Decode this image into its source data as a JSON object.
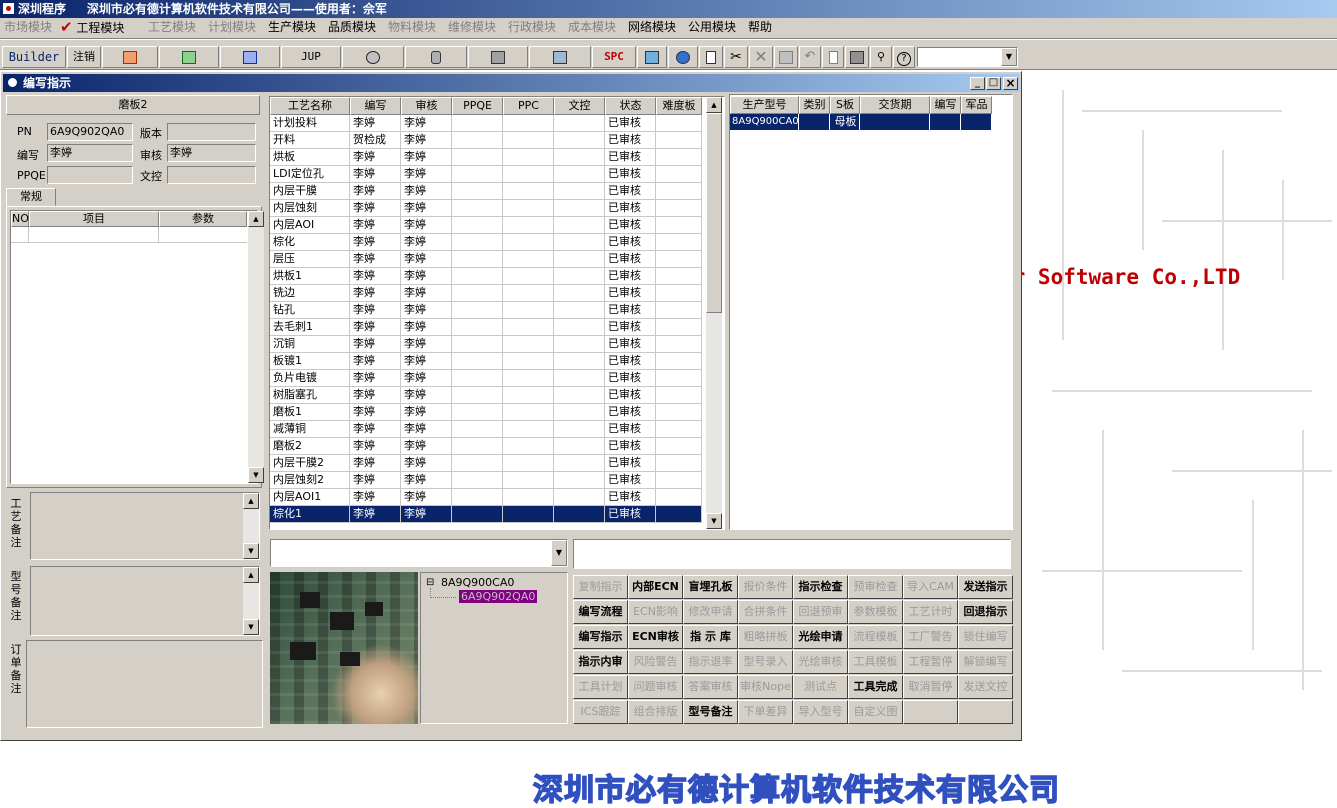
{
  "app": {
    "title_left": "深圳程序",
    "title_main": "深圳市必有德计算机软件技术有限公司——使用者：佘军"
  },
  "menu": [
    {
      "label": "市场模块",
      "enabled": false
    },
    {
      "label": "工程模块",
      "enabled": true,
      "checked": true
    },
    {
      "label": "工艺模块",
      "enabled": false
    },
    {
      "label": "计划模块",
      "enabled": false
    },
    {
      "label": "生产模块",
      "enabled": true
    },
    {
      "label": "品质模块",
      "enabled": true
    },
    {
      "label": "物料模块",
      "enabled": false
    },
    {
      "label": "维修模块",
      "enabled": false
    },
    {
      "label": "行政模块",
      "enabled": false
    },
    {
      "label": "成本模块",
      "enabled": false
    },
    {
      "label": "网络模块",
      "enabled": true
    },
    {
      "label": "公用模块",
      "enabled": true
    },
    {
      "label": "帮助",
      "enabled": true
    }
  ],
  "toolbar": {
    "builder": "Builder",
    "logout": "注销",
    "jup": "JUP",
    "spc": "SPC"
  },
  "window": {
    "title": "编写指示",
    "min": "_",
    "max": "□",
    "close": "×"
  },
  "left": {
    "caption": "磨板2",
    "pn_label": "PN",
    "pn_value": "6A9Q902QA0",
    "version_label": "版本",
    "version_value": "",
    "writer_label": "编写",
    "writer_value": "李婷",
    "review_label": "审核",
    "review_value": "李婷",
    "ppqe_label": "PPQE",
    "ppqe_value": "",
    "doc_label": "文控",
    "doc_value": "",
    "tab": "常规",
    "cols": [
      "NO",
      "项目",
      "参数"
    ],
    "note1": "工艺备注",
    "note2": "型号备注",
    "note3": "订单备注"
  },
  "grid": {
    "headers": [
      "工艺名称",
      "编写",
      "审核",
      "PPQE",
      "PPC",
      "文控",
      "状态",
      "难度板"
    ],
    "rows": [
      [
        "计划投料",
        "李婷",
        "李婷",
        "",
        "",
        "",
        "已审核",
        ""
      ],
      [
        "开料",
        "贺检成",
        "李婷",
        "",
        "",
        "",
        "已审核",
        ""
      ],
      [
        "烘板",
        "李婷",
        "李婷",
        "",
        "",
        "",
        "已审核",
        ""
      ],
      [
        "LDI定位孔",
        "李婷",
        "李婷",
        "",
        "",
        "",
        "已审核",
        ""
      ],
      [
        "内层干膜",
        "李婷",
        "李婷",
        "",
        "",
        "",
        "已审核",
        ""
      ],
      [
        "内层蚀刻",
        "李婷",
        "李婷",
        "",
        "",
        "",
        "已审核",
        ""
      ],
      [
        "内层AOI",
        "李婷",
        "李婷",
        "",
        "",
        "",
        "已审核",
        ""
      ],
      [
        "棕化",
        "李婷",
        "李婷",
        "",
        "",
        "",
        "已审核",
        ""
      ],
      [
        "层压",
        "李婷",
        "李婷",
        "",
        "",
        "",
        "已审核",
        ""
      ],
      [
        "烘板1",
        "李婷",
        "李婷",
        "",
        "",
        "",
        "已审核",
        ""
      ],
      [
        "铣边",
        "李婷",
        "李婷",
        "",
        "",
        "",
        "已审核",
        ""
      ],
      [
        "钻孔",
        "李婷",
        "李婷",
        "",
        "",
        "",
        "已审核",
        ""
      ],
      [
        "去毛刺1",
        "李婷",
        "李婷",
        "",
        "",
        "",
        "已审核",
        ""
      ],
      [
        "沉铜",
        "李婷",
        "李婷",
        "",
        "",
        "",
        "已审核",
        ""
      ],
      [
        "板镀1",
        "李婷",
        "李婷",
        "",
        "",
        "",
        "已审核",
        ""
      ],
      [
        "负片电镀",
        "李婷",
        "李婷",
        "",
        "",
        "",
        "已审核",
        ""
      ],
      [
        "树脂塞孔",
        "李婷",
        "李婷",
        "",
        "",
        "",
        "已审核",
        ""
      ],
      [
        "磨板1",
        "李婷",
        "李婷",
        "",
        "",
        "",
        "已审核",
        ""
      ],
      [
        "减薄铜",
        "李婷",
        "李婷",
        "",
        "",
        "",
        "已审核",
        ""
      ],
      [
        "磨板2",
        "李婷",
        "李婷",
        "",
        "",
        "",
        "已审核",
        ""
      ],
      [
        "内层干膜2",
        "李婷",
        "李婷",
        "",
        "",
        "",
        "已审核",
        ""
      ],
      [
        "内层蚀刻2",
        "李婷",
        "李婷",
        "",
        "",
        "",
        "已审核",
        ""
      ],
      [
        "内层AOI1",
        "李婷",
        "李婷",
        "",
        "",
        "",
        "已审核",
        ""
      ],
      [
        "棕化1",
        "李婷",
        "李婷",
        "",
        "",
        "",
        "已审核",
        ""
      ]
    ]
  },
  "product": {
    "headers": [
      "生产型号",
      "类别",
      "S板",
      "交货期",
      "编写",
      "军品"
    ],
    "row": [
      "8A9Q900CA0",
      "",
      "母板",
      "",
      "",
      ""
    ]
  },
  "tree": {
    "root": "8A9Q900CA0",
    "child": "6A9Q902QA0"
  },
  "actions": [
    [
      {
        "label": "复制指示",
        "enabled": false
      },
      {
        "label": "内部ECN",
        "enabled": true
      },
      {
        "label": "盲埋孔板",
        "enabled": true
      },
      {
        "label": "报价条件",
        "enabled": false
      },
      {
        "label": "指示检查",
        "enabled": true
      },
      {
        "label": "预审检查",
        "enabled": false
      },
      {
        "label": "导入CAM",
        "enabled": false
      },
      {
        "label": "发送指示",
        "enabled": true
      }
    ],
    [
      {
        "label": "编写流程",
        "enabled": true
      },
      {
        "label": "ECN影响",
        "enabled": false
      },
      {
        "label": "修改申请",
        "enabled": false
      },
      {
        "label": "合拼条件",
        "enabled": false
      },
      {
        "label": "回退预审",
        "enabled": false
      },
      {
        "label": "参数模板",
        "enabled": false
      },
      {
        "label": "工艺计时",
        "enabled": false
      },
      {
        "label": "回退指示",
        "enabled": true
      }
    ],
    [
      {
        "label": "编写指示",
        "enabled": true
      },
      {
        "label": "ECN审核",
        "enabled": true
      },
      {
        "label": "指 示 库",
        "enabled": true
      },
      {
        "label": "粗略拼板",
        "enabled": false
      },
      {
        "label": "光绘申请",
        "enabled": true
      },
      {
        "label": "流程模板",
        "enabled": false
      },
      {
        "label": "工厂警告",
        "enabled": false
      },
      {
        "label": "锁住编写",
        "enabled": false
      }
    ],
    [
      {
        "label": "指示内审",
        "enabled": true
      },
      {
        "label": "风险警告",
        "enabled": false
      },
      {
        "label": "指示退率",
        "enabled": false
      },
      {
        "label": "型号录入",
        "enabled": false
      },
      {
        "label": "光绘审核",
        "enabled": false
      },
      {
        "label": "工具模板",
        "enabled": false
      },
      {
        "label": "工程暂停",
        "enabled": false
      },
      {
        "label": "解锁编写",
        "enabled": false
      }
    ],
    [
      {
        "label": "工具计划",
        "enabled": false
      },
      {
        "label": "问题审核",
        "enabled": false
      },
      {
        "label": "答案审核",
        "enabled": false
      },
      {
        "label": "审核Nope",
        "enabled": false
      },
      {
        "label": "测试点",
        "enabled": false
      },
      {
        "label": "工具完成",
        "enabled": true
      },
      {
        "label": "取消暂停",
        "enabled": false
      },
      {
        "label": "发送文控",
        "enabled": false
      }
    ],
    [
      {
        "label": "ICS跟踪",
        "enabled": false
      },
      {
        "label": "组合排版",
        "enabled": false
      },
      {
        "label": "型号备注",
        "enabled": true
      },
      {
        "label": "下单差异",
        "enabled": false
      },
      {
        "label": "导入型号",
        "enabled": false
      },
      {
        "label": "自定义图",
        "enabled": false
      },
      {
        "label": "",
        "enabled": false
      },
      {
        "label": "",
        "enabled": false
      }
    ]
  ],
  "background": {
    "software_text": "er Software Co.,LTD",
    "company_text": "深圳市必有德计算机软件技术有限公司"
  },
  "colors": {
    "title_bar": "#0a246a",
    "selection": "#0a246a",
    "face": "#d4d0c8",
    "brand_red": "#c00000",
    "brand_blue": "#3050c0"
  }
}
